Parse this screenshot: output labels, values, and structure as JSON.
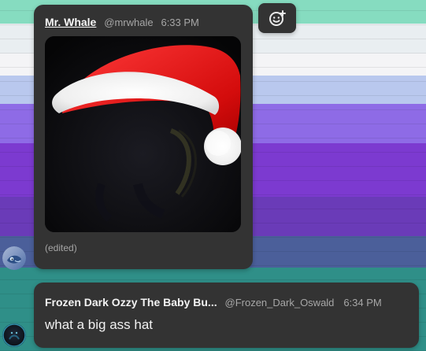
{
  "chat": {
    "message1": {
      "username": "Mr. Whale",
      "handle": "@mrwhale",
      "time": "6:33 PM",
      "edited": "(edited)"
    },
    "message2": {
      "username": "Frozen Dark Ozzy The Baby Bu...",
      "handle": "@Frozen_Dark_Oswald",
      "time": "6:34 PM",
      "text": "what a big ass hat"
    }
  },
  "icons": {
    "reaction": "add-reaction-icon",
    "media": "santa-hat-image"
  }
}
